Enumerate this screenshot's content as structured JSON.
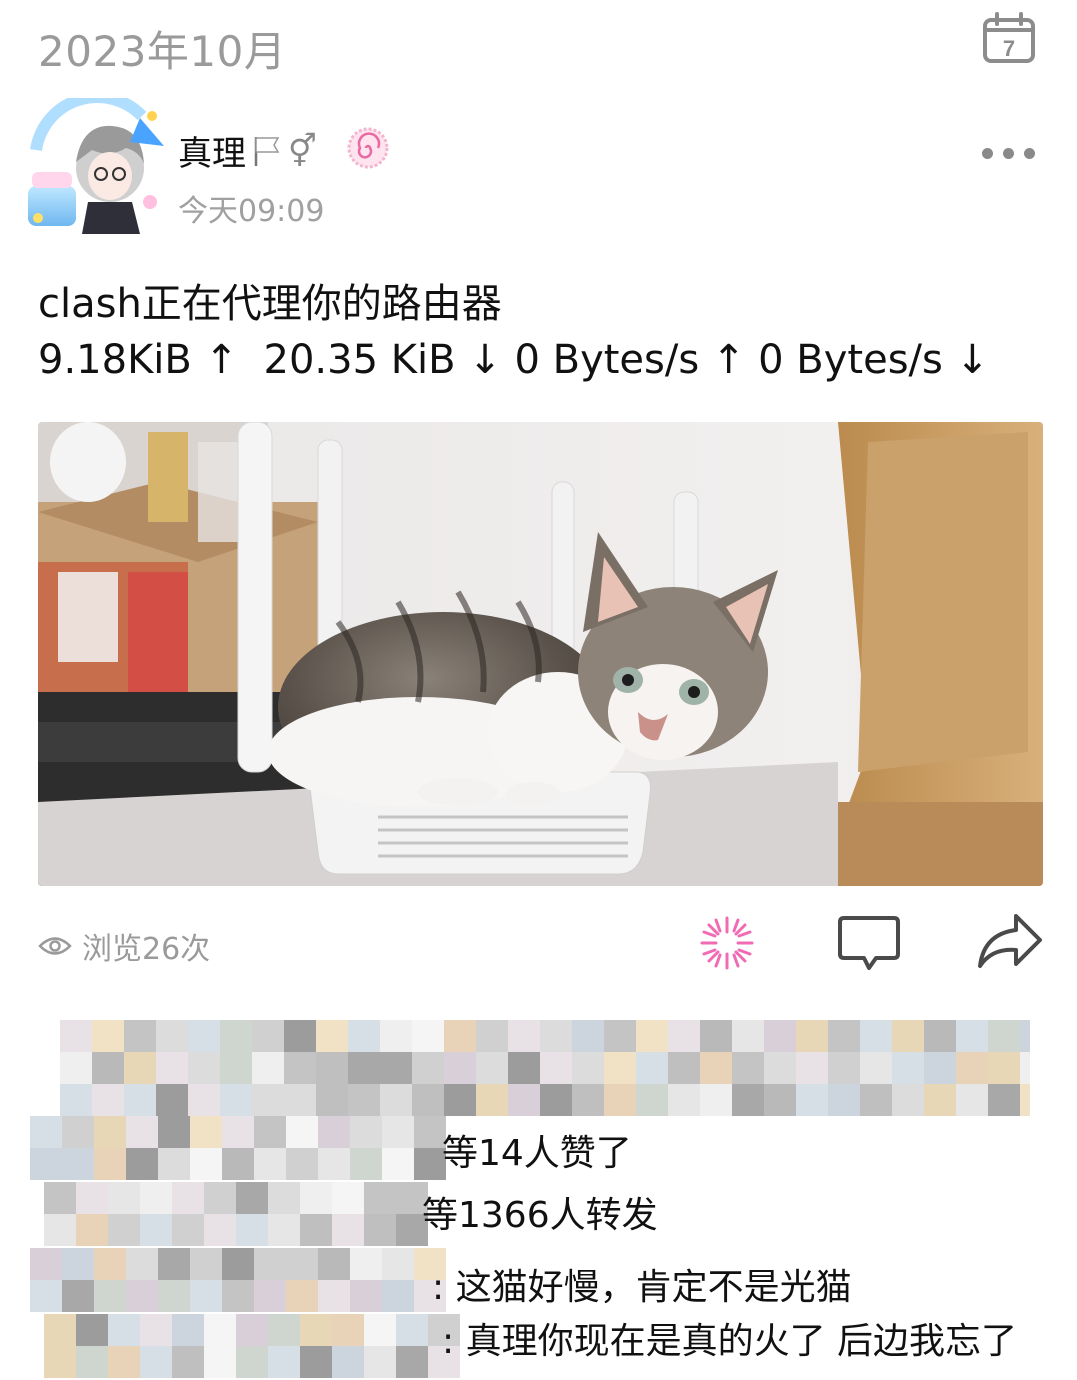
{
  "header": {
    "month": "2023年10月",
    "calendar_day": "7"
  },
  "post": {
    "user_name": "真理",
    "flag_icon": "white-flag-icon",
    "gender_symbol": "⚥",
    "time": "今天09:09",
    "text_line1": "clash正在代理你的路由器",
    "text_line2": "9.18KiB ↑  20.35 KiB ↓ 0 Bytes/s ↑ 0 Bytes/s ↓",
    "views": "浏览26次"
  },
  "interactions": {
    "likes_text": "等14人赞了",
    "reposts_text": "等1366人转发",
    "comment1_text": ": 这猫好慢，肯定不是光猫",
    "comment2_text": ": 真理你现在是真的火了 后边我忘了"
  },
  "colors": {
    "accent_pink": "#f06bb4",
    "icon_gray": "#8a8a8a",
    "text_secondary": "#9a9a9a"
  }
}
